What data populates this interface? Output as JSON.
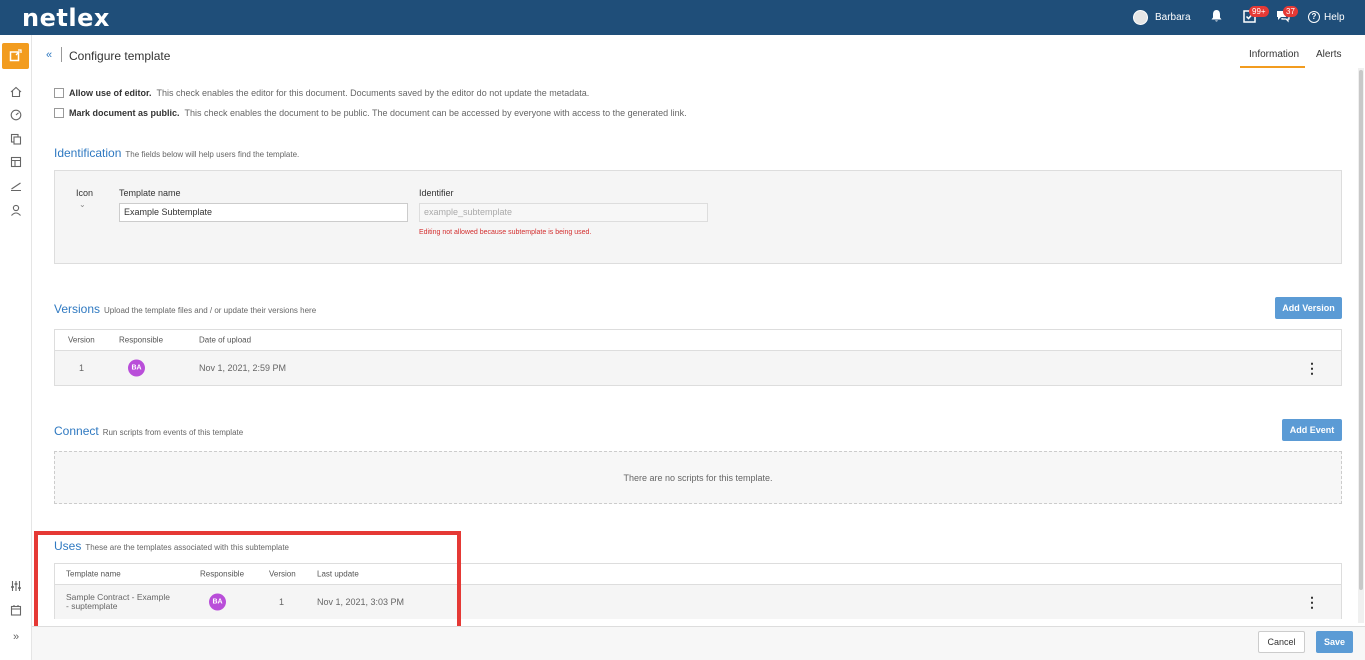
{
  "app": {
    "logo": "netlex"
  },
  "topbar": {
    "user_name": "Barbara",
    "tasks_badge": "99+",
    "messages_badge": "37",
    "help_label": "Help"
  },
  "header": {
    "collapse_glyph": "«",
    "title": "Configure template",
    "tabs": [
      {
        "label": "Information"
      },
      {
        "label": "Alerts"
      }
    ]
  },
  "options": {
    "editor": {
      "label": "Allow use of editor.",
      "desc": "This check enables the editor for this document. Documents saved by the editor do not update the metadata."
    },
    "public": {
      "label": "Mark document as public.",
      "desc": "This check enables the document to be public. The document can be accessed by everyone with access to the generated link."
    }
  },
  "identification": {
    "title": "Identification",
    "desc": "The fields below will help users find the template.",
    "icon_label": "Icon",
    "name_label": "Template name",
    "name_value": "Example Subtemplate",
    "identifier_label": "Identifier",
    "identifier_placeholder": "example_subtemplate",
    "identifier_error": "Editing not allowed because subtemplate is being used."
  },
  "versions": {
    "title": "Versions",
    "desc": "Upload the template files and / or update their versions here",
    "add_button": "Add Version",
    "columns": [
      "Version",
      "Responsible",
      "Date of upload"
    ],
    "rows": [
      {
        "version": "1",
        "responsible": "BA",
        "date": "Nov 1, 2021, 2:59 PM"
      }
    ]
  },
  "connect": {
    "title": "Connect",
    "desc": "Run scripts from events of this template",
    "add_button": "Add Event",
    "empty": "There are no scripts for this template."
  },
  "uses": {
    "title": "Uses",
    "desc": "These are the templates associated with this subtemplate",
    "columns": [
      "Template name",
      "Responsible",
      "Version",
      "Last update"
    ],
    "rows": [
      {
        "name_line1": "Sample Contract - Example",
        "name_line2": "- suptemplate",
        "responsible": "BA",
        "version": "1",
        "last_update": "Nov 1, 2021, 3:03 PM"
      }
    ]
  },
  "footer": {
    "cancel": "Cancel",
    "save": "Save"
  },
  "colors": {
    "topbar": "#1f4e79",
    "accent": "#f29c1f",
    "link": "#2f79c1",
    "primary_button": "#5b9bd5",
    "error": "#d32f2f",
    "avatar": "#b94ed9",
    "highlight": "#e53935"
  }
}
